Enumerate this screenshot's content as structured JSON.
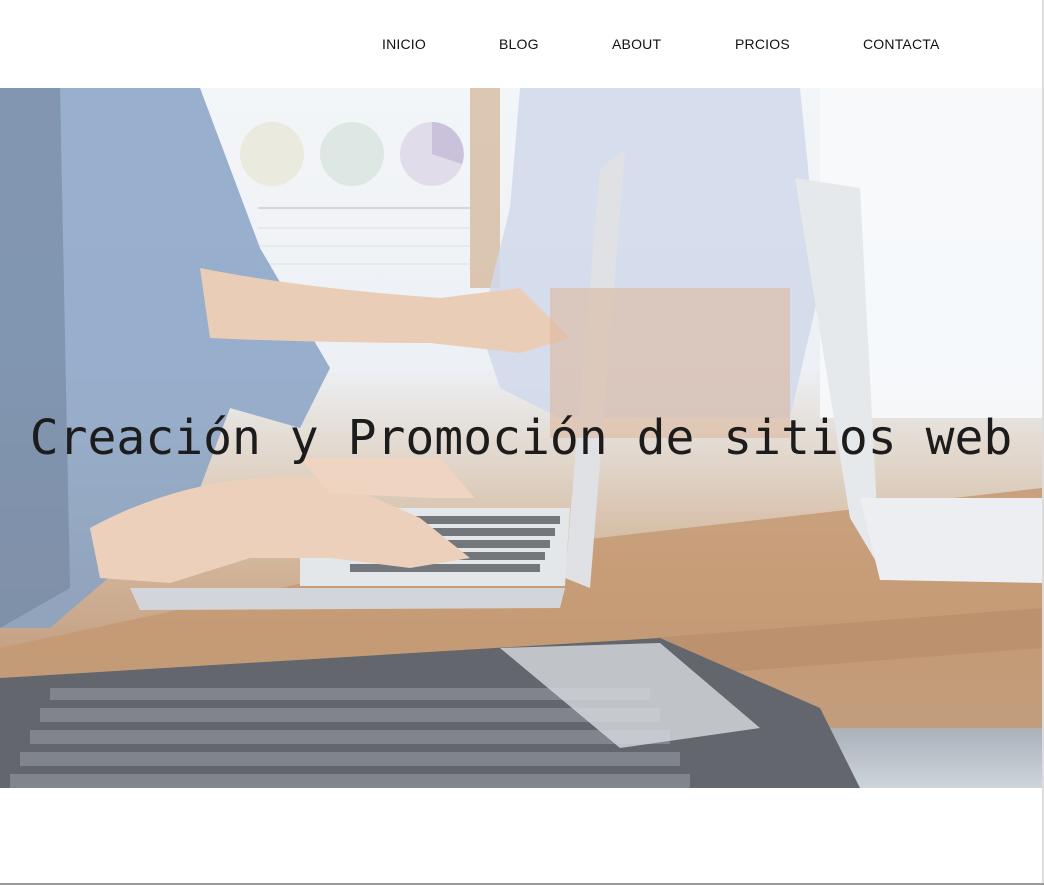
{
  "nav": {
    "items": [
      {
        "label": "INICIO"
      },
      {
        "label": "BLOG"
      },
      {
        "label": "ABOUT"
      },
      {
        "label": "PRCIOS"
      },
      {
        "label": "CONTACTA"
      }
    ]
  },
  "hero": {
    "title": "Creación y Promoción de sitios web",
    "image": "office-team-laptops-photo"
  }
}
